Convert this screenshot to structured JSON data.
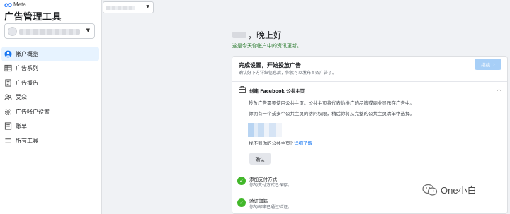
{
  "brand": {
    "meta_label": "Meta",
    "app_title": "广告管理工具"
  },
  "sidebar": {
    "items": [
      {
        "label": "帐户概览",
        "icon": "account-overview-icon",
        "active": true
      },
      {
        "label": "广告系列",
        "icon": "campaigns-icon",
        "active": false
      },
      {
        "label": "广告报告",
        "icon": "ads-report-icon",
        "active": false
      },
      {
        "label": "受众",
        "icon": "audiences-icon",
        "active": false
      },
      {
        "label": "广告帐户设置",
        "icon": "ad-account-settings-icon",
        "active": false
      },
      {
        "label": "账单",
        "icon": "billing-icon",
        "active": false
      },
      {
        "label": "所有工具",
        "icon": "all-tools-icon",
        "active": false
      }
    ]
  },
  "greeting": {
    "text": "，晚上好",
    "subtitle": "这是今天你帐户中的资讯更新。"
  },
  "setup_card": {
    "title": "完成设置，开始投放广告",
    "subtitle": "确认好下方详细信息后，你就可以发布首条广告了。",
    "continue_label": "继续",
    "step": {
      "label": "创建 Facebook 公共主页",
      "para1": "投放广告需要使用公共主页。公共主页将代表你推广的品牌或商业显示在广告中。",
      "para2": "你拥有一个或多个公共主页的访问权限，稍后你将从完整的公共主页清单中选择。",
      "not_found": "找不到你的公共主页?",
      "learn_more": "详细了解",
      "confirm_label": "确认"
    },
    "completed": [
      {
        "title": "添加支付方式",
        "subtitle": "你的支付方式已保存。"
      },
      {
        "title": "验证邮箱",
        "subtitle": "你的邮箱已通过验证。"
      }
    ]
  },
  "watermark": {
    "text": "One小白"
  },
  "colors": {
    "active_bg": "#e7f3ff",
    "accent": "#1877f2",
    "success": "#42b72a",
    "greet_sub": "#2e7d32"
  }
}
